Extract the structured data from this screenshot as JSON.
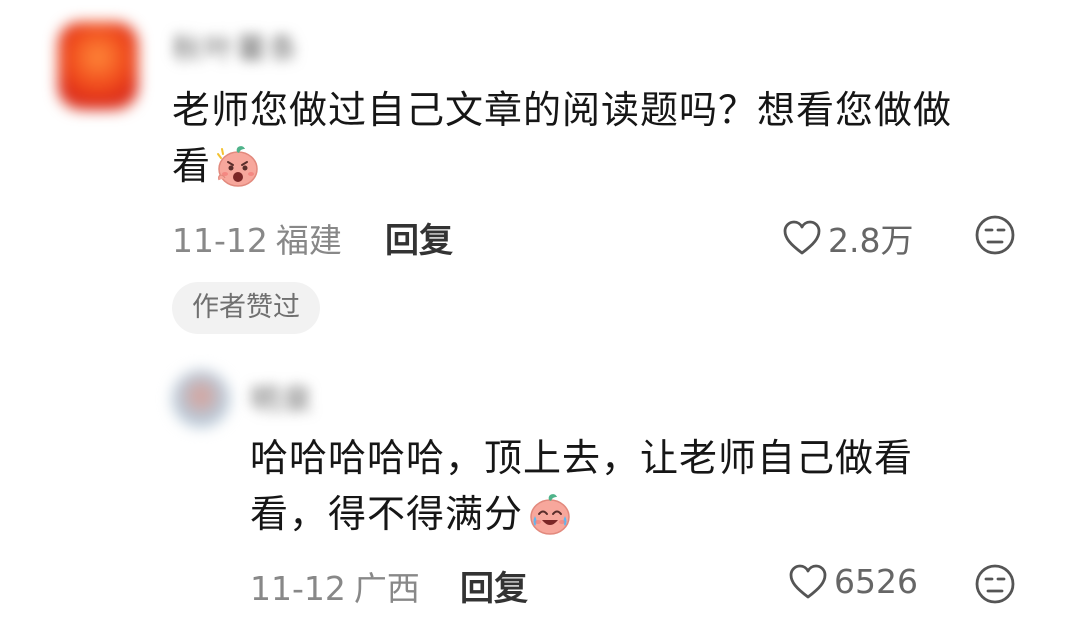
{
  "comments": [
    {
      "username": "秋叶薯条",
      "text_line1": "老师您做过自己文章的阅读题吗？想看您做做",
      "text_line2": "看",
      "date": "11-12",
      "region": "福建",
      "reply_label": "回复",
      "likes": "2.8万",
      "author_badge": "作者赞过",
      "emoji": "shocked-face-emoji"
    },
    {
      "username": "明泉",
      "text_line1": "哈哈哈哈哈，顶上去，让老师自己做看",
      "text_line2": "看，得不得满分",
      "date": "11-12",
      "region": "广西",
      "reply_label": "回复",
      "likes": "6526",
      "emoji": "laugh-cry-emoji"
    }
  ],
  "colors": {
    "text": "#161616",
    "meta": "#888888",
    "badge_bg": "#f2f2f2",
    "emoji_skin": "#f6a39b",
    "emoji_leaf": "#4fb38a"
  }
}
